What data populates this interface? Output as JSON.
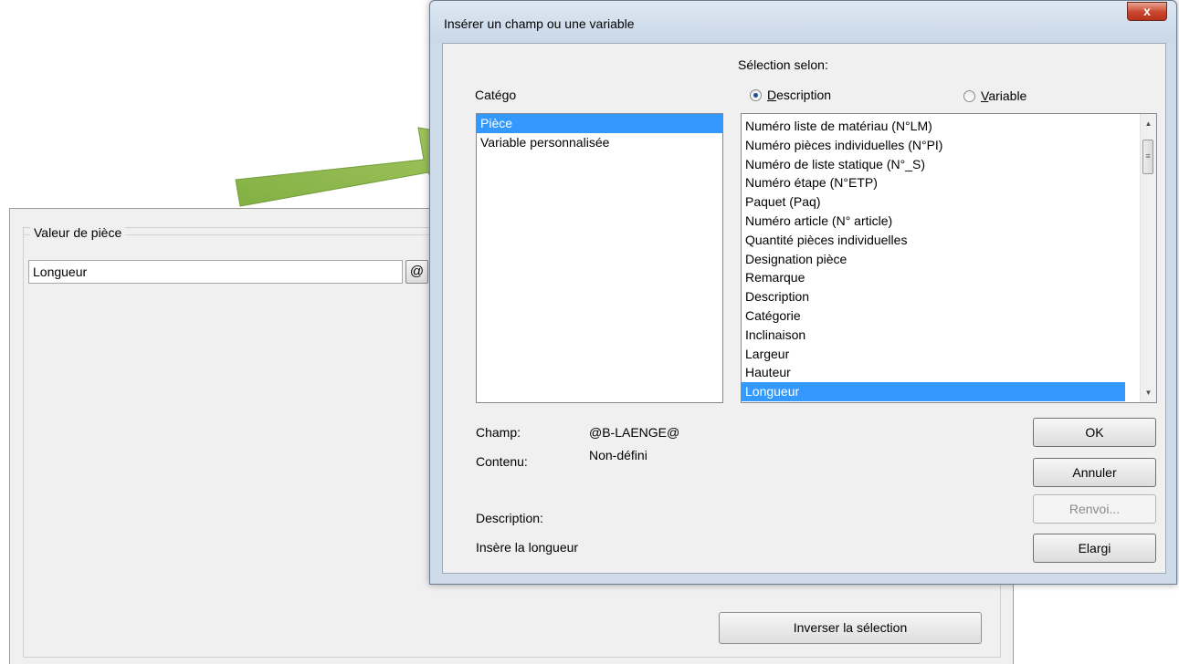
{
  "background_panel": {
    "group_title": "Valeur de pièce",
    "input_value": "Longueur",
    "at_button_label": "@",
    "invert_button_label": "Inverser la sélection"
  },
  "dialog": {
    "title": "Insérer un champ ou une variable",
    "close_label": "x",
    "selection_label": "Sélection selon:",
    "radio_description": {
      "mnemonic": "D",
      "rest": "escription",
      "checked": true
    },
    "radio_variable": {
      "mnemonic": "V",
      "rest": "ariable",
      "checked": false
    },
    "category_label": "Catégo",
    "categories": [
      {
        "label": "Pièce",
        "selected": true
      },
      {
        "label": "Variable personnalisée",
        "selected": false
      }
    ],
    "fields": [
      {
        "label": "Numéro liste de matériau (N°LM)",
        "selected": false
      },
      {
        "label": "Numéro pièces individuelles (N°PI)",
        "selected": false
      },
      {
        "label": "Numéro de liste statique (N°_S)",
        "selected": false
      },
      {
        "label": "Numéro étape (N°ETP)",
        "selected": false
      },
      {
        "label": "Paquet (Paq)",
        "selected": false
      },
      {
        "label": "Numéro article (N° article)",
        "selected": false
      },
      {
        "label": "Quantité pièces individuelles",
        "selected": false
      },
      {
        "label": "Designation pièce",
        "selected": false
      },
      {
        "label": "Remarque",
        "selected": false
      },
      {
        "label": "Description",
        "selected": false
      },
      {
        "label": "Catégorie",
        "selected": false
      },
      {
        "label": "Inclinaison",
        "selected": false
      },
      {
        "label": "Largeur",
        "selected": false
      },
      {
        "label": "Hauteur",
        "selected": false
      },
      {
        "label": "Longueur",
        "selected": true
      }
    ],
    "champ_label": "Champ:",
    "champ_value": "@B-LAENGE@",
    "contenu_label": "Contenu:",
    "contenu_value": "Non-défini",
    "description_label": "Description:",
    "description_value": "Insère la longueur",
    "buttons": {
      "ok": "OK",
      "annuler": "Annuler",
      "renvoi": "Renvoi...",
      "elargi": "Elargi"
    }
  },
  "colors": {
    "selection": "#3399ff",
    "arrow": "#8cb84a",
    "close_button": "#c9452c"
  }
}
